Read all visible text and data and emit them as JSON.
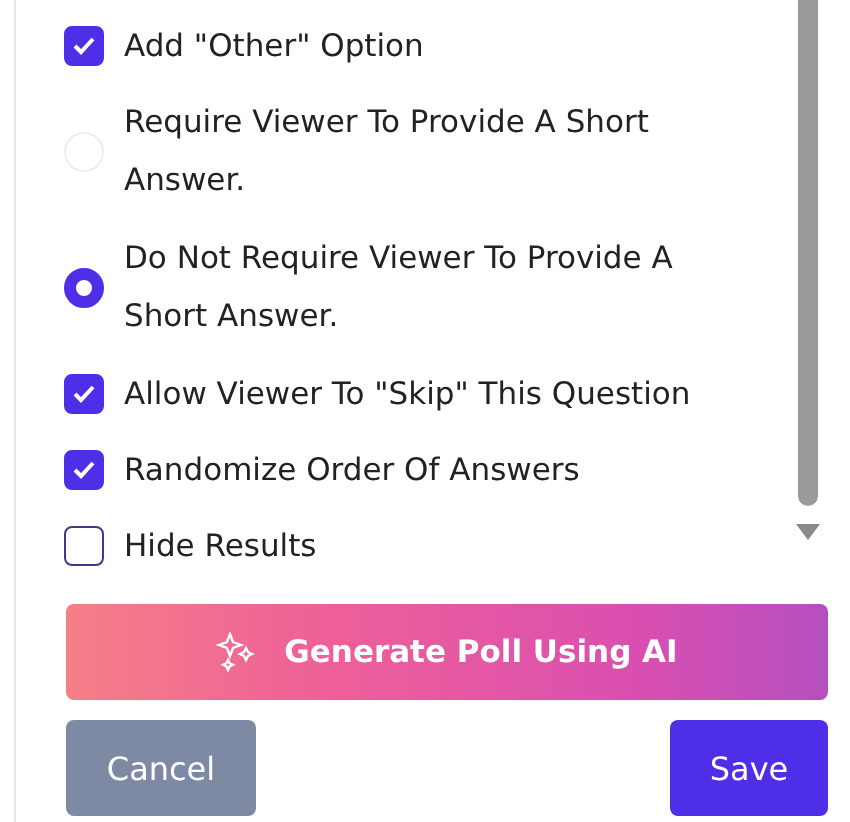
{
  "options": [
    {
      "kind": "checkbox",
      "label": "Add \"Other\" Option",
      "checked": true
    },
    {
      "kind": "radio",
      "label": "Require Viewer To Provide A Short Answer.",
      "selected": false
    },
    {
      "kind": "radio",
      "label": "Do Not Require Viewer To Provide A Short Answer.",
      "selected": true
    },
    {
      "kind": "checkbox",
      "label": "Allow Viewer To \"Skip\" This Question",
      "checked": true
    },
    {
      "kind": "checkbox",
      "label": "Randomize Order Of Answers",
      "checked": true
    },
    {
      "kind": "checkbox",
      "label": "Hide Results",
      "checked": false
    }
  ],
  "ai_button": "Generate Poll Using AI",
  "buttons": [
    {
      "kind": "cancel",
      "label": "Cancel"
    },
    {
      "kind": "save",
      "label": "Save"
    }
  ]
}
